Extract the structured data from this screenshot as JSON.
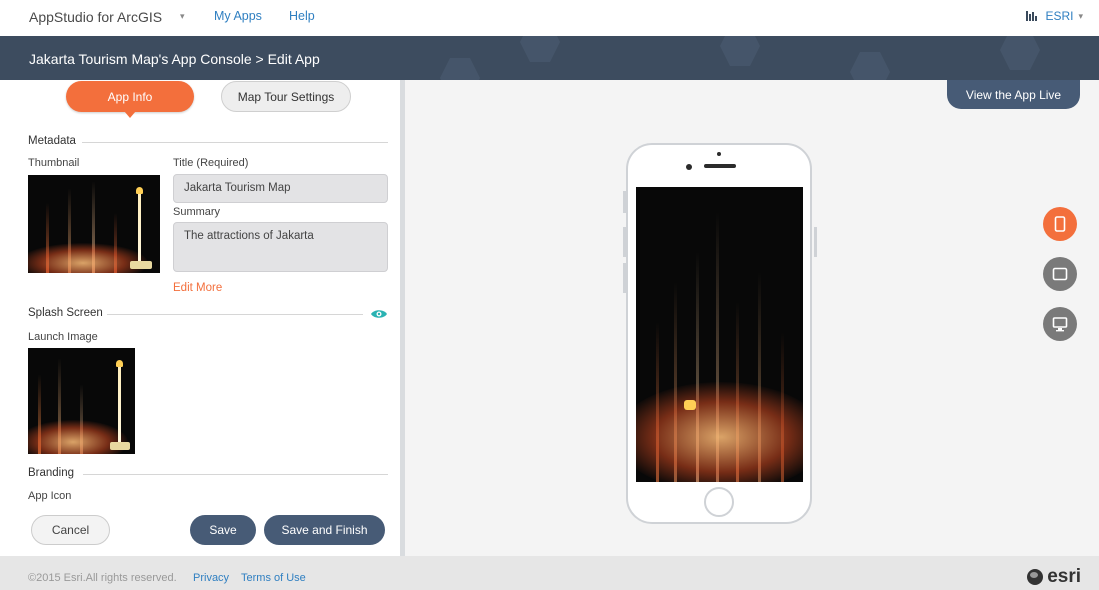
{
  "topbar": {
    "app_title": "AppStudio for ArcGIS",
    "caret": "▾",
    "nav": [
      "My Apps",
      "Help"
    ],
    "org": "ESRI",
    "org_caret": "▾"
  },
  "banner": {
    "title": "Jakarta Tourism Map's App Console > Edit App"
  },
  "tabs": [
    {
      "label": "App Info",
      "active": true
    },
    {
      "label": "Map Tour Settings",
      "active": false
    }
  ],
  "metadata": {
    "heading": "Metadata",
    "thumbnail_label": "Thumbnail",
    "title_label": "Title (Required)",
    "title_value": "Jakarta Tourism Map",
    "summary_label": "Summary",
    "summary_value": "The attractions of Jakarta",
    "edit_more": "Edit More"
  },
  "splash": {
    "heading": "Splash Screen",
    "launch_label": "Launch Image"
  },
  "branding": {
    "heading": "Branding",
    "app_icon_label": "App Icon"
  },
  "actions": {
    "cancel": "Cancel",
    "save": "Save",
    "save_finish": "Save and Finish"
  },
  "preview": {
    "view_live": "View the App Live",
    "devices": [
      {
        "icon": "phone-icon",
        "active": true,
        "color": "#f36f3c"
      },
      {
        "icon": "tablet-icon",
        "active": false,
        "color": "#7a7a7a"
      },
      {
        "icon": "desktop-icon",
        "active": false,
        "color": "#7a7a7a"
      }
    ]
  },
  "footer": {
    "copyright": "©2015 Esri.All rights reserved.",
    "privacy": "Privacy",
    "terms": "Terms of Use",
    "brand": "esri"
  },
  "colors": {
    "accent": "#f36f3c",
    "banner": "#3d4c5f",
    "button": "#475b76",
    "link": "#2f7fc1"
  }
}
